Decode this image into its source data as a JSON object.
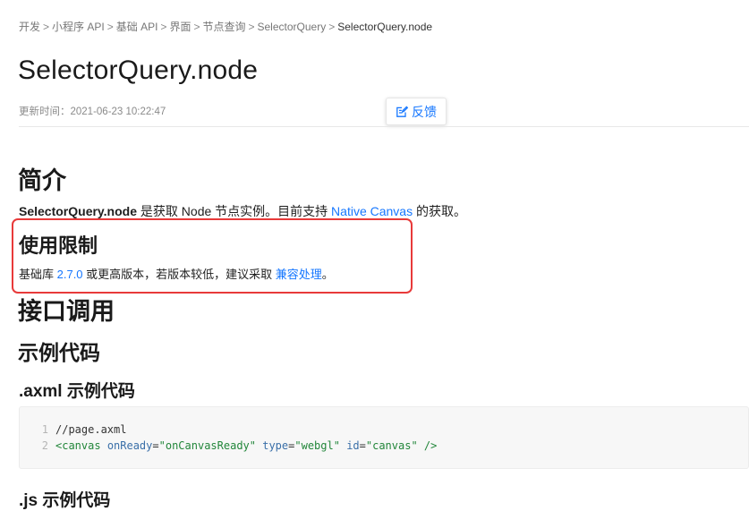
{
  "breadcrumb": {
    "items": [
      "开发",
      "小程序 API",
      "基础 API",
      "界面",
      "节点查询",
      "SelectorQuery",
      "SelectorQuery.node"
    ],
    "separator": ">"
  },
  "page": {
    "title": "SelectorQuery.node",
    "updated": "更新时间：2021-06-23 10:22:47",
    "feedback_label": "反馈"
  },
  "intro": {
    "heading": "简介",
    "api_name": "SelectorQuery.node",
    "text1": " 是获取 Node 节点实例。目前支持 ",
    "link": "Native Canvas",
    "text2": " 的获取。"
  },
  "limit": {
    "heading": "使用限制",
    "text1": "基础库 ",
    "version_link": "2.7.0",
    "text2": " 或更高版本，若版本较低，建议采取 ",
    "compat_link": "兼容处理",
    "text3": "。"
  },
  "sections": {
    "api_call": "接口调用",
    "example_code": "示例代码",
    "axml_example": ".axml 示例代码",
    "next_heading": ".js 示例代码"
  },
  "code": {
    "line_numbers": [
      "1",
      "2"
    ],
    "line1": "//page.axml",
    "line2": {
      "open": "<canvas",
      "attr1": "onReady",
      "val1": "\"onCanvasReady\"",
      "attr2": "type",
      "val2": "\"webgl\"",
      "attr3": "id",
      "val3": "\"canvas\"",
      "close": "/>"
    }
  },
  "colors": {
    "link": "#1677ff",
    "highlight_border": "#e83a3a",
    "code_background": "#f7f7f7"
  },
  "icons": {
    "feedback": "edit-note-icon"
  }
}
